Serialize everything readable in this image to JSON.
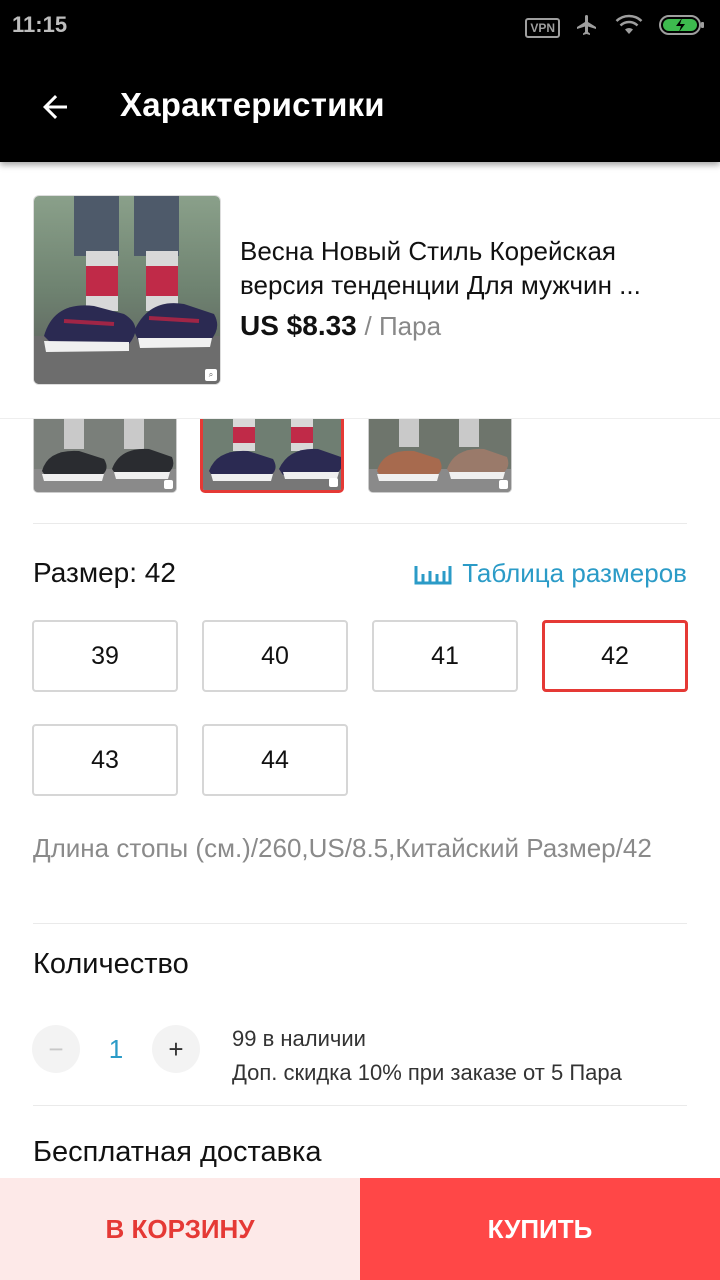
{
  "status_bar": {
    "time": "11:15",
    "vpn": "VPN",
    "icons": [
      "vpn-icon",
      "airplane-icon",
      "wifi-icon",
      "battery-charging-icon"
    ]
  },
  "app_bar": {
    "title": "Характеристики",
    "back_icon": "arrow-left-icon"
  },
  "product": {
    "title_line1": "Весна Новый Стиль Корейская",
    "title_line2": "версия тенденции Для мужчин ...",
    "price": "US $8.33",
    "price_unit": "/ Пара"
  },
  "variants": [
    {
      "color": "#2a2c30",
      "selected": false
    },
    {
      "color": "#2b2a52",
      "selected": true
    },
    {
      "color": "#a76a4e",
      "selected": false
    }
  ],
  "size": {
    "label": "Размер: 42",
    "chart_link": "Таблица размеров",
    "chart_icon": "ruler-icon",
    "options": [
      "39",
      "40",
      "41",
      "42",
      "43",
      "44"
    ],
    "selected": "42",
    "description": "Длина стопы (см.)/260,US/8.5,Китайский Размер/42"
  },
  "quantity": {
    "title": "Количество",
    "minus": "−",
    "value": "1",
    "plus": "+",
    "stock": "99 в наличии",
    "discount": "Доп. скидка 10% при заказе от 5 Пара"
  },
  "delivery": {
    "title": "Бесплатная доставка"
  },
  "actions": {
    "cart_label": "В КОРЗИНУ",
    "buy_label": "КУПИТЬ"
  },
  "colors": {
    "accent_red": "#e53935",
    "buy_red": "#ff4747",
    "link_blue": "#2b9bc7"
  }
}
